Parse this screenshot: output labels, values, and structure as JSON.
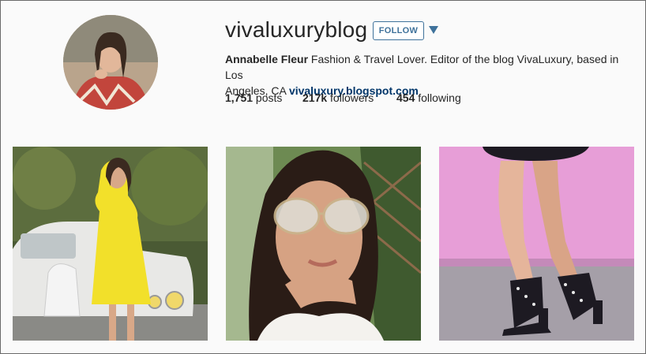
{
  "profile": {
    "username": "vivaluxuryblog",
    "follow_label": "FOLLOW",
    "full_name": "Annabelle Fleur",
    "bio_line1_rest": " Fashion & Travel Lover. Editor of the blog VivaLuxury, based in Los",
    "bio_line2": "Angeles, CA ",
    "website": "vivaluxury.blogspot.com"
  },
  "stats": {
    "posts_count": "1,751",
    "posts_label": " posts",
    "followers_count": "217k",
    "followers_label": " followers",
    "following_count": "454",
    "following_label": " following"
  },
  "colors": {
    "accent": "#3f729b",
    "link": "#003569",
    "background": "#fafafa"
  },
  "icons": {
    "dropdown": "dropdown-triangle-icon"
  }
}
